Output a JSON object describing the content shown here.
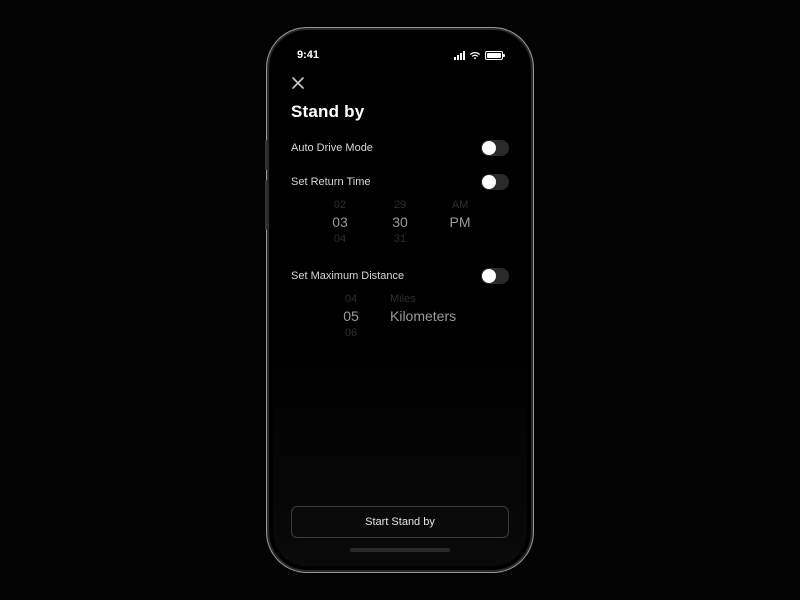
{
  "status": {
    "time": "9:41"
  },
  "title": "Stand by",
  "toggles": {
    "auto_drive": {
      "label": "Auto Drive Mode"
    },
    "return_time": {
      "label": "Set Return Time"
    },
    "max_distance": {
      "label": "Set Maximum Distance"
    }
  },
  "time_picker": {
    "hour": {
      "prev": "02",
      "cur": "03",
      "next": "04"
    },
    "minute": {
      "prev": "29",
      "cur": "30",
      "next": "31"
    },
    "ampm": {
      "prev": "AM",
      "cur": "PM",
      "next": ""
    }
  },
  "distance_picker": {
    "value": {
      "prev": "04",
      "cur": "05",
      "next": "06"
    },
    "unit": {
      "prev": "Miles",
      "cur": "Kilometers",
      "next": ""
    }
  },
  "cta": {
    "label": "Start Stand by"
  }
}
